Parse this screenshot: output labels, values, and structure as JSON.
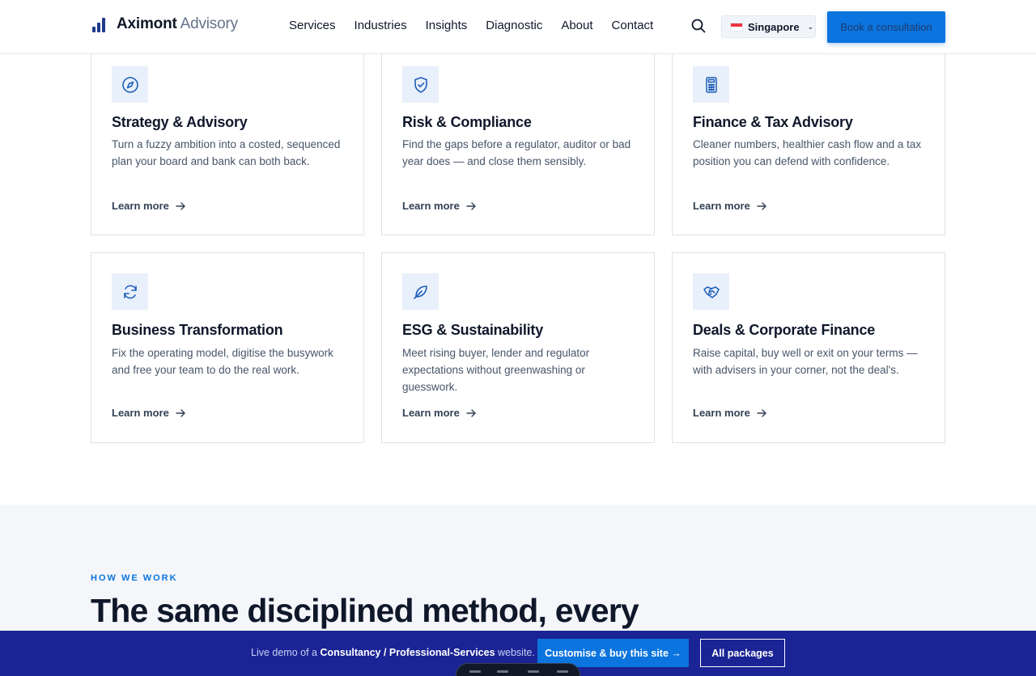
{
  "header": {
    "brand_strong": "Aximont",
    "brand_light": "Advisory",
    "nav": [
      "Services",
      "Industries",
      "Insights",
      "Diagnostic",
      "About",
      "Contact"
    ],
    "region_label": "Singapore",
    "cta_label": "Book a consultation"
  },
  "cards": [
    {
      "title": "Strategy & Advisory",
      "description": "Turn a fuzzy ambition into a costed, sequenced plan your board and bank can both back.",
      "link": "Learn more",
      "icon": "compass-icon"
    },
    {
      "title": "Risk & Compliance",
      "description": "Find the gaps before a regulator, auditor or bad year does — and close them sensibly.",
      "link": "Learn more",
      "icon": "shield-check-icon"
    },
    {
      "title": "Finance & Tax Advisory",
      "description": "Cleaner numbers, healthier cash flow and a tax position you can defend with confidence.",
      "link": "Learn more",
      "icon": "calculator-icon"
    },
    {
      "title": "Business Transformation",
      "description": "Fix the operating model, digitise the busywork and free your team to do the real work.",
      "link": "Learn more",
      "icon": "refresh-icon"
    },
    {
      "title": "ESG & Sustainability",
      "description": "Meet rising buyer, lender and regulator expectations without greenwashing or guesswork.",
      "link": "Learn more",
      "icon": "leaf-icon"
    },
    {
      "title": "Deals & Corporate Finance",
      "description": "Raise capital, buy well or exit on your terms — with advisers in your corner, not the deal's.",
      "link": "Learn more",
      "icon": "handshake-icon"
    }
  ],
  "how": {
    "eyebrow": "HOW WE WORK",
    "heading": "The same disciplined method, every"
  },
  "banner": {
    "msg_prefix": "Live demo of a ",
    "msg_strong": "Consultancy / Professional-Services",
    "msg_suffix": " website.",
    "buy_label": "Customise & buy this site →",
    "packages_label": "All packages"
  },
  "colors": {
    "accent": "#0b74de",
    "banner": "#1a2494",
    "icon_bg": "#e8f0fb"
  }
}
